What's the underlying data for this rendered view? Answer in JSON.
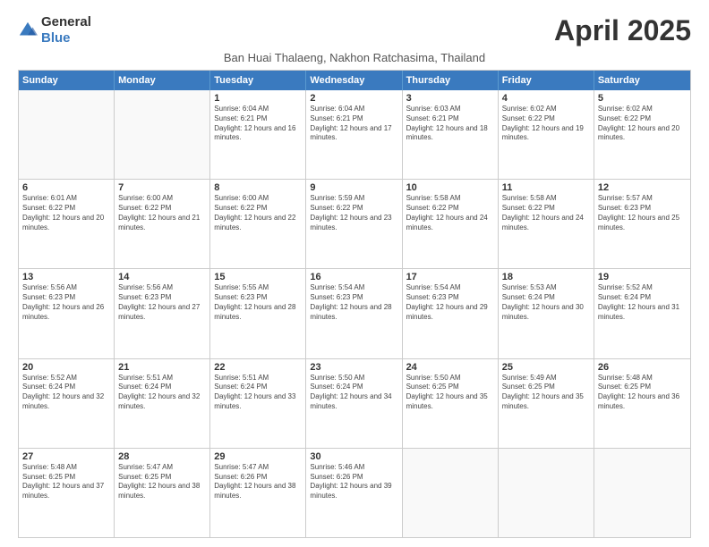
{
  "logo": {
    "general": "General",
    "blue": "Blue"
  },
  "title": "April 2025",
  "location": "Ban Huai Thalaeng, Nakhon Ratchasima, Thailand",
  "header_days": [
    "Sunday",
    "Monday",
    "Tuesday",
    "Wednesday",
    "Thursday",
    "Friday",
    "Saturday"
  ],
  "weeks": [
    [
      {
        "day": "",
        "info": ""
      },
      {
        "day": "",
        "info": ""
      },
      {
        "day": "1",
        "info": "Sunrise: 6:04 AM\nSunset: 6:21 PM\nDaylight: 12 hours and 16 minutes."
      },
      {
        "day": "2",
        "info": "Sunrise: 6:04 AM\nSunset: 6:21 PM\nDaylight: 12 hours and 17 minutes."
      },
      {
        "day": "3",
        "info": "Sunrise: 6:03 AM\nSunset: 6:21 PM\nDaylight: 12 hours and 18 minutes."
      },
      {
        "day": "4",
        "info": "Sunrise: 6:02 AM\nSunset: 6:22 PM\nDaylight: 12 hours and 19 minutes."
      },
      {
        "day": "5",
        "info": "Sunrise: 6:02 AM\nSunset: 6:22 PM\nDaylight: 12 hours and 20 minutes."
      }
    ],
    [
      {
        "day": "6",
        "info": "Sunrise: 6:01 AM\nSunset: 6:22 PM\nDaylight: 12 hours and 20 minutes."
      },
      {
        "day": "7",
        "info": "Sunrise: 6:00 AM\nSunset: 6:22 PM\nDaylight: 12 hours and 21 minutes."
      },
      {
        "day": "8",
        "info": "Sunrise: 6:00 AM\nSunset: 6:22 PM\nDaylight: 12 hours and 22 minutes."
      },
      {
        "day": "9",
        "info": "Sunrise: 5:59 AM\nSunset: 6:22 PM\nDaylight: 12 hours and 23 minutes."
      },
      {
        "day": "10",
        "info": "Sunrise: 5:58 AM\nSunset: 6:22 PM\nDaylight: 12 hours and 24 minutes."
      },
      {
        "day": "11",
        "info": "Sunrise: 5:58 AM\nSunset: 6:22 PM\nDaylight: 12 hours and 24 minutes."
      },
      {
        "day": "12",
        "info": "Sunrise: 5:57 AM\nSunset: 6:23 PM\nDaylight: 12 hours and 25 minutes."
      }
    ],
    [
      {
        "day": "13",
        "info": "Sunrise: 5:56 AM\nSunset: 6:23 PM\nDaylight: 12 hours and 26 minutes."
      },
      {
        "day": "14",
        "info": "Sunrise: 5:56 AM\nSunset: 6:23 PM\nDaylight: 12 hours and 27 minutes."
      },
      {
        "day": "15",
        "info": "Sunrise: 5:55 AM\nSunset: 6:23 PM\nDaylight: 12 hours and 28 minutes."
      },
      {
        "day": "16",
        "info": "Sunrise: 5:54 AM\nSunset: 6:23 PM\nDaylight: 12 hours and 28 minutes."
      },
      {
        "day": "17",
        "info": "Sunrise: 5:54 AM\nSunset: 6:23 PM\nDaylight: 12 hours and 29 minutes."
      },
      {
        "day": "18",
        "info": "Sunrise: 5:53 AM\nSunset: 6:24 PM\nDaylight: 12 hours and 30 minutes."
      },
      {
        "day": "19",
        "info": "Sunrise: 5:52 AM\nSunset: 6:24 PM\nDaylight: 12 hours and 31 minutes."
      }
    ],
    [
      {
        "day": "20",
        "info": "Sunrise: 5:52 AM\nSunset: 6:24 PM\nDaylight: 12 hours and 32 minutes."
      },
      {
        "day": "21",
        "info": "Sunrise: 5:51 AM\nSunset: 6:24 PM\nDaylight: 12 hours and 32 minutes."
      },
      {
        "day": "22",
        "info": "Sunrise: 5:51 AM\nSunset: 6:24 PM\nDaylight: 12 hours and 33 minutes."
      },
      {
        "day": "23",
        "info": "Sunrise: 5:50 AM\nSunset: 6:24 PM\nDaylight: 12 hours and 34 minutes."
      },
      {
        "day": "24",
        "info": "Sunrise: 5:50 AM\nSunset: 6:25 PM\nDaylight: 12 hours and 35 minutes."
      },
      {
        "day": "25",
        "info": "Sunrise: 5:49 AM\nSunset: 6:25 PM\nDaylight: 12 hours and 35 minutes."
      },
      {
        "day": "26",
        "info": "Sunrise: 5:48 AM\nSunset: 6:25 PM\nDaylight: 12 hours and 36 minutes."
      }
    ],
    [
      {
        "day": "27",
        "info": "Sunrise: 5:48 AM\nSunset: 6:25 PM\nDaylight: 12 hours and 37 minutes."
      },
      {
        "day": "28",
        "info": "Sunrise: 5:47 AM\nSunset: 6:25 PM\nDaylight: 12 hours and 38 minutes."
      },
      {
        "day": "29",
        "info": "Sunrise: 5:47 AM\nSunset: 6:26 PM\nDaylight: 12 hours and 38 minutes."
      },
      {
        "day": "30",
        "info": "Sunrise: 5:46 AM\nSunset: 6:26 PM\nDaylight: 12 hours and 39 minutes."
      },
      {
        "day": "",
        "info": ""
      },
      {
        "day": "",
        "info": ""
      },
      {
        "day": "",
        "info": ""
      }
    ]
  ]
}
